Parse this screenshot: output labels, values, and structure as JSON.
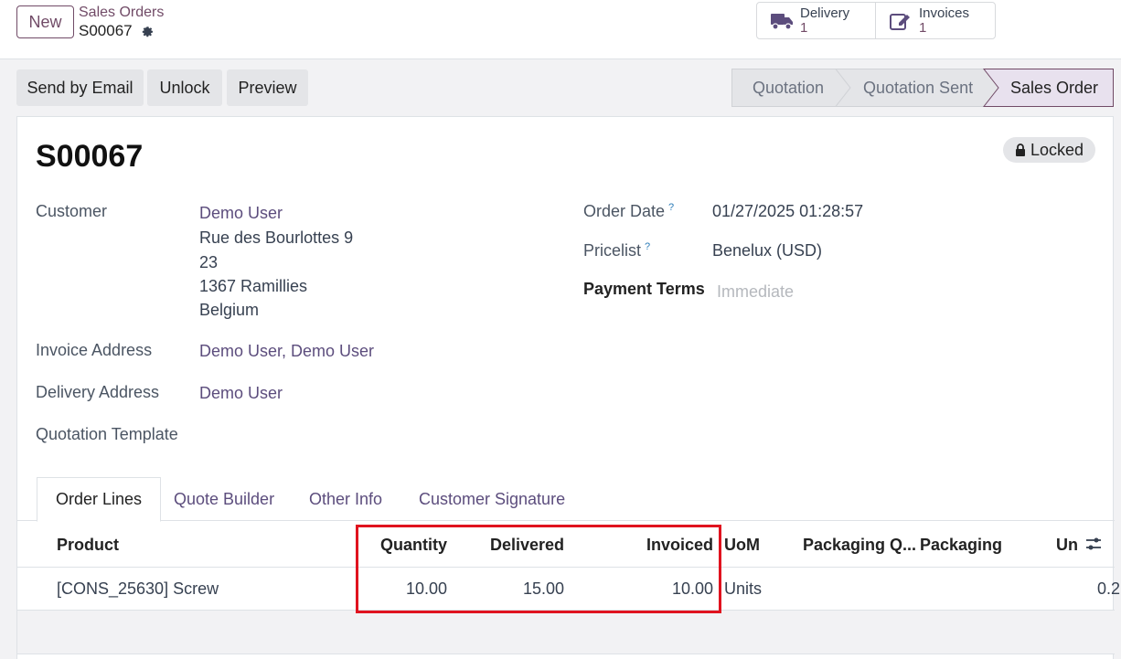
{
  "topbar": {
    "new_label": "New",
    "breadcrumb_parent": "Sales Orders",
    "breadcrumb_current": "S00067",
    "smart_buttons": [
      {
        "label": "Delivery",
        "value": "1",
        "icon": "truck-icon"
      },
      {
        "label": "Invoices",
        "value": "1",
        "icon": "pencil-square-icon"
      }
    ]
  },
  "actions": {
    "send_email": "Send by Email",
    "unlock": "Unlock",
    "preview": "Preview"
  },
  "statusbar": {
    "stages": [
      "Quotation",
      "Quotation Sent",
      "Sales Order"
    ],
    "active_stage": "Sales Order"
  },
  "form": {
    "title": "S00067",
    "locked_badge": "Locked",
    "customer_label": "Customer",
    "customer_name": "Demo User",
    "customer_address": [
      "Rue des Bourlottes 9",
      "23",
      "1367 Ramillies",
      "Belgium"
    ],
    "invoice_address_label": "Invoice Address",
    "invoice_address": "Demo User, Demo User",
    "delivery_address_label": "Delivery Address",
    "delivery_address": "Demo User",
    "quotation_template_label": "Quotation Template",
    "order_date_label": "Order Date",
    "order_date": "01/27/2025 01:28:57",
    "pricelist_label": "Pricelist",
    "pricelist": "Benelux (USD)",
    "payment_terms_label": "Payment Terms",
    "payment_terms_placeholder": "Immediate",
    "tooltip_mark": "?"
  },
  "tabs": [
    "Order Lines",
    "Quote Builder",
    "Other Info",
    "Customer Signature"
  ],
  "table": {
    "columns": [
      "Product",
      "Quantity",
      "Delivered",
      "Invoiced",
      "UoM",
      "Packaging Q...",
      "Packaging",
      "Un"
    ],
    "rows": [
      {
        "product": "[CONS_25630] Screw",
        "quantity": "10.00",
        "delivered": "15.00",
        "invoiced": "10.00",
        "uom": "Units",
        "unit_price_partial": "0.2"
      }
    ]
  },
  "colors": {
    "brand": "#714b67",
    "link": "#5c4d7d",
    "highlight": "#e0131f"
  }
}
